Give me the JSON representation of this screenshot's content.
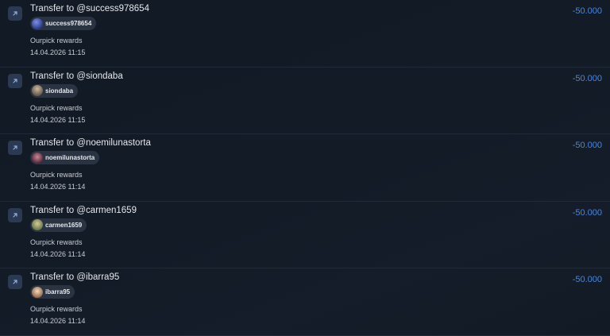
{
  "transactions": [
    {
      "title": "Transfer to @success978654",
      "user": "success978654",
      "avatar_color": "#3b4fa8",
      "description": "Ourpick rewards",
      "date": "14.04.2026 11:15",
      "amount": "-50.000",
      "icon": "arrow-up-right-icon"
    },
    {
      "title": "Transfer to @siondaba",
      "user": "siondaba",
      "avatar_color": "#8a7a6a",
      "description": "Ourpick rewards",
      "date": "14.04.2026 11:15",
      "amount": "-50.000",
      "icon": "arrow-up-right-icon"
    },
    {
      "title": "Transfer to @noemilunastorta",
      "user": "noemilunastorta",
      "avatar_color": "#7a4a5a",
      "description": "Ourpick rewards",
      "date": "14.04.2026 11:14",
      "amount": "-50.000",
      "icon": "arrow-up-right-icon"
    },
    {
      "title": "Transfer to @carmen1659",
      "user": "carmen1659",
      "avatar_color": "#8a9a6a",
      "description": "Ourpick rewards",
      "date": "14.04.2026 11:14",
      "amount": "-50.000",
      "icon": "arrow-up-right-icon"
    },
    {
      "title": "Transfer to @ibarra95",
      "user": "ibarra95",
      "avatar_color": "#b89a7a",
      "description": "Ourpick rewards",
      "date": "14.04.2026 11:14",
      "amount": "-50.000",
      "icon": "arrow-up-right-icon"
    }
  ],
  "colors": {
    "background": "#121a26",
    "amount": "#4a86dc",
    "chip": "#2a3342",
    "icon_bg": "#2b3a52"
  }
}
